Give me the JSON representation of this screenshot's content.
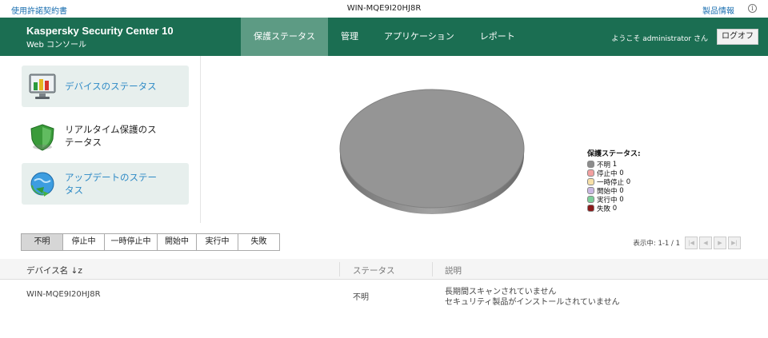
{
  "topbar": {
    "license_link": "使用許諾契約書",
    "hostname": "WIN-MQE9I20HJ8R",
    "product_info_link": "製品情報",
    "info_icon": "info-icon"
  },
  "header": {
    "brand_line1": "Kaspersky Security Center 10",
    "brand_line2": "Web コンソール",
    "tabs": [
      {
        "label": "保護ステータス"
      },
      {
        "label": "管理"
      },
      {
        "label": "アプリケーション"
      },
      {
        "label": "レポート"
      }
    ],
    "welcome": "ようこそ administrator さん",
    "logout_label": "ログオフ"
  },
  "status_cards": [
    {
      "label": "デバイスのステータス",
      "icon": "monitor-chart-icon"
    },
    {
      "label1": "リアルタイム保護のス",
      "label2": "テータス",
      "icon": "shield-icon"
    },
    {
      "label1": "アップデートのステー",
      "label2": "タス",
      "icon": "update-globe-icon"
    }
  ],
  "legend": {
    "title": "保護ステータス:",
    "items": [
      {
        "label": "不明",
        "count": "1",
        "color": "#8c8c8c"
      },
      {
        "label": "停止中",
        "count": "0",
        "color": "#f2a0a0"
      },
      {
        "label": "一時停止",
        "count": "0",
        "color": "#f7e0a8"
      },
      {
        "label": "開始中",
        "count": "0",
        "color": "#c9b8e3"
      },
      {
        "label": "実行中",
        "count": "0",
        "color": "#7ccf9a"
      },
      {
        "label": "失敗",
        "count": "0",
        "color": "#8b1a1a"
      }
    ]
  },
  "filters": [
    {
      "label": "不明"
    },
    {
      "label": "停止中"
    },
    {
      "label": "一時停止中"
    },
    {
      "label": "開始中"
    },
    {
      "label": "実行中"
    },
    {
      "label": "失敗"
    }
  ],
  "pager": {
    "info": "表示中: 1-1 / 1"
  },
  "table": {
    "headers": {
      "device": "デバイス名 ↓z",
      "status": "ステータス",
      "description": "説明"
    },
    "rows": [
      {
        "device": "WIN-MQE9I20HJ8R",
        "status": "不明",
        "desc1": "長期間スキャンされていません",
        "desc2": "セキュリティ製品がインストールされていません"
      }
    ]
  },
  "colors": {
    "header_bg": "#1b6e52",
    "active_tab": "#5d9b84",
    "link": "#1a6fb0"
  }
}
